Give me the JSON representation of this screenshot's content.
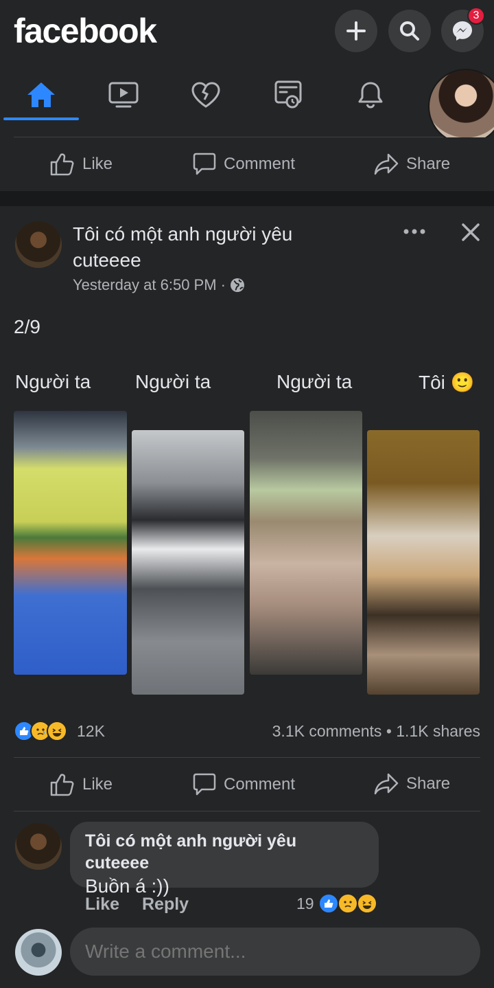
{
  "header": {
    "logo": "facebook",
    "messenger_badge": "3"
  },
  "nav": {
    "items": [
      "home",
      "watch",
      "dating",
      "marketplace",
      "notifications",
      "profile"
    ]
  },
  "top_actions": {
    "like": "Like",
    "comment": "Comment",
    "share": "Share"
  },
  "post": {
    "author": "Tôi có một anh người yêu cuteeee",
    "time": "Yesterday at 6:50 PM · ",
    "text": "2/9",
    "captions": [
      "Người ta",
      "Người ta",
      "Người ta",
      "Tôi 🙂"
    ],
    "reaction_count": "12K",
    "comments_shares": "3.1K comments • 1.1K shares",
    "actions": {
      "like": "Like",
      "comment": "Comment",
      "share": "Share"
    }
  },
  "comment": {
    "author": "Tôi có một anh người yêu cuteeee",
    "body": "Buồn á :))",
    "like": "Like",
    "reply": "Reply",
    "reaction_count": "19"
  },
  "composer": {
    "placeholder": "Write a comment..."
  },
  "colors": {
    "accent": "#2d88ff",
    "background": "#18191a",
    "card": "#242526",
    "badge": "#e41e3f"
  }
}
